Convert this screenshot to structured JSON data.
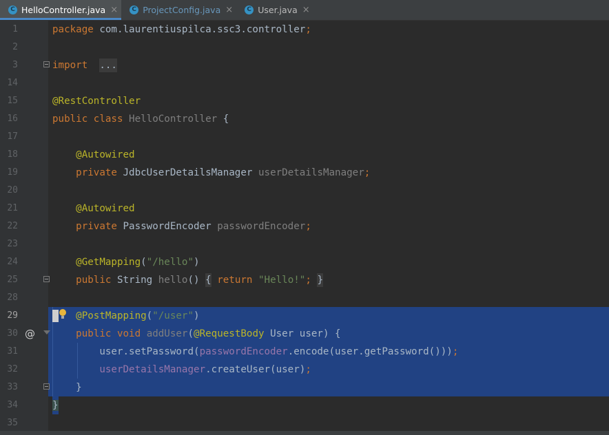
{
  "tabs": [
    {
      "label": "HelloController.java",
      "active": true,
      "icon": "class-icon"
    },
    {
      "label": "ProjectConfig.java",
      "active": false,
      "icon": "class-icon"
    },
    {
      "label": "User.java",
      "active": false,
      "icon": "class-icon"
    }
  ],
  "tab_close_glyph": "×",
  "class_icon_glyph": "C",
  "current_line": "29",
  "lines": [
    {
      "num": "1",
      "tokens": [
        [
          "kw",
          "package"
        ],
        [
          "",
          "com.laurentiuspilca.ssc3.controller"
        ],
        [
          "kw",
          ";"
        ]
      ]
    },
    {
      "num": "2",
      "tokens": []
    },
    {
      "num": "3",
      "tokens": [
        [
          "kw",
          "import"
        ],
        [
          "",
          ""
        ],
        [
          "foldbox",
          "..."
        ]
      ],
      "fold": true
    },
    {
      "num": "14",
      "tokens": []
    },
    {
      "num": "15",
      "tokens": [
        [
          "ann",
          "@RestController"
        ]
      ]
    },
    {
      "num": "16",
      "tokens": [
        [
          "kw",
          "public class"
        ],
        [
          "unused",
          "HelloController"
        ],
        [
          "",
          "{"
        ]
      ]
    },
    {
      "num": "17",
      "tokens": []
    },
    {
      "num": "18",
      "tokens": [
        [
          "ann",
          "@Autowired"
        ]
      ],
      "indent": 1
    },
    {
      "num": "19",
      "tokens": [
        [
          "kw",
          "private"
        ],
        [
          "",
          "JdbcUserDetailsManager"
        ],
        [
          "unused",
          "userDetailsManager"
        ],
        [
          "kw",
          ";"
        ]
      ],
      "indent": 1
    },
    {
      "num": "20",
      "tokens": []
    },
    {
      "num": "21",
      "tokens": [
        [
          "ann",
          "@Autowired"
        ]
      ],
      "indent": 1
    },
    {
      "num": "22",
      "tokens": [
        [
          "kw",
          "private"
        ],
        [
          "",
          "PasswordEncoder"
        ],
        [
          "unused",
          "passwordEncoder"
        ],
        [
          "kw",
          ";"
        ]
      ],
      "indent": 1
    },
    {
      "num": "23",
      "tokens": []
    },
    {
      "num": "24",
      "tokens": [
        [
          "ann",
          "@GetMapping"
        ],
        [
          "",
          "("
        ],
        [
          "str",
          "\"/hello\""
        ],
        [
          "",
          ")"
        ]
      ],
      "indent": 1
    },
    {
      "num": "25",
      "tokens": [
        [
          "kw",
          "public"
        ],
        [
          "",
          "String"
        ],
        [
          "unused",
          "hello"
        ],
        [
          "",
          "()"
        ],
        [
          "foldbox",
          "{"
        ],
        [
          "kw",
          "return"
        ],
        [
          "str",
          "\"Hello!\""
        ],
        [
          "kw",
          ";"
        ],
        [
          "foldbox",
          "}"
        ]
      ],
      "indent": 1,
      "fold": true
    },
    {
      "num": "28",
      "tokens": []
    },
    {
      "num": "29",
      "tokens": [
        [
          "ann",
          "@PostMapping"
        ],
        [
          "",
          "("
        ],
        [
          "str",
          "\"/user\""
        ],
        [
          "",
          ")"
        ]
      ],
      "indent": 1,
      "sel": true,
      "bulb": true
    },
    {
      "num": "30",
      "tokens": [
        [
          "kw",
          "public void"
        ],
        [
          "unused",
          "addUser"
        ],
        [
          "",
          "("
        ],
        [
          "ann",
          "@RequestBody"
        ],
        [
          "",
          "User user) {"
        ]
      ],
      "indent": 1,
      "sel": true,
      "at": "@",
      "folddown": true
    },
    {
      "num": "31",
      "tokens": [
        [
          "",
          "user.setPassword("
        ],
        [
          "fld",
          "passwordEncoder"
        ],
        [
          "",
          ".encode(user.getPassword()))"
        ],
        [
          "kw",
          ";"
        ]
      ],
      "indent": 2,
      "sel": true
    },
    {
      "num": "32",
      "tokens": [
        [
          "fld",
          "userDetailsManager"
        ],
        [
          "",
          ".createUser(user)"
        ],
        [
          "kw",
          ";"
        ]
      ],
      "indent": 2,
      "sel": true
    },
    {
      "num": "33",
      "tokens": [
        [
          "",
          "}"
        ]
      ],
      "indent": 1,
      "sel": true,
      "fold": true
    },
    {
      "num": "34",
      "tokens": [
        [
          "match-brace",
          "}"
        ]
      ],
      "sel_partial": true
    },
    {
      "num": "35",
      "tokens": []
    }
  ]
}
